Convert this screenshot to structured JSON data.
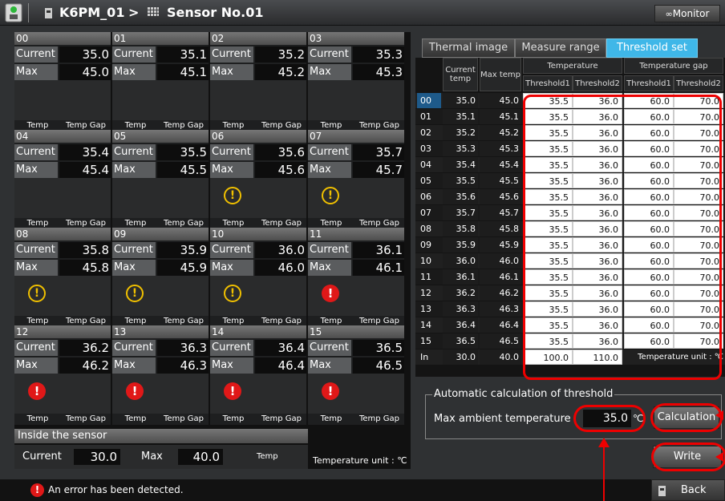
{
  "title": {
    "device": "K6PM_01",
    "separator": ">",
    "sensor": "Sensor No.01",
    "monitor_label": "Monitor"
  },
  "cell_labels": {
    "current": "Current",
    "max": "Max",
    "temp": "Temp",
    "temp_gap": "Temp Gap"
  },
  "cells": [
    {
      "id": "00",
      "current": "35.0",
      "max": "45.0",
      "status": "ok"
    },
    {
      "id": "01",
      "current": "35.1",
      "max": "45.1",
      "status": "ok"
    },
    {
      "id": "02",
      "current": "35.2",
      "max": "45.2",
      "status": "ok"
    },
    {
      "id": "03",
      "current": "35.3",
      "max": "45.3",
      "status": "ok"
    },
    {
      "id": "04",
      "current": "35.4",
      "max": "45.4",
      "status": "ok"
    },
    {
      "id": "05",
      "current": "35.5",
      "max": "45.5",
      "status": "ok"
    },
    {
      "id": "06",
      "current": "35.6",
      "max": "45.6",
      "status": "warning"
    },
    {
      "id": "07",
      "current": "35.7",
      "max": "45.7",
      "status": "warning"
    },
    {
      "id": "08",
      "current": "35.8",
      "max": "45.8",
      "status": "warning"
    },
    {
      "id": "09",
      "current": "35.9",
      "max": "45.9",
      "status": "warning"
    },
    {
      "id": "10",
      "current": "36.0",
      "max": "46.0",
      "status": "warning"
    },
    {
      "id": "11",
      "current": "36.1",
      "max": "46.1",
      "status": "error"
    },
    {
      "id": "12",
      "current": "36.2",
      "max": "46.2",
      "status": "error"
    },
    {
      "id": "13",
      "current": "36.3",
      "max": "46.3",
      "status": "error"
    },
    {
      "id": "14",
      "current": "36.4",
      "max": "46.4",
      "status": "error"
    },
    {
      "id": "15",
      "current": "36.5",
      "max": "46.5",
      "status": "error"
    }
  ],
  "inside_sensor": {
    "title": "Inside the sensor",
    "current_label": "Current",
    "current": "30.0",
    "max_label": "Max",
    "max": "40.0",
    "temp_label": "Temp"
  },
  "left_unit": "Temperature unit : ℃",
  "tabs": [
    {
      "label": "Thermal image",
      "active": false
    },
    {
      "label": "Measure range",
      "active": false
    },
    {
      "label": "Threshold set",
      "active": true
    }
  ],
  "table": {
    "header": {
      "current": "Current temp",
      "max": "Max temp",
      "temperature": "Temperature",
      "temperature_gap": "Temperature gap",
      "threshold1": "Threshold1",
      "threshold2": "Threshold2",
      "threshold1_gap": "Threshold1",
      "threshold2_gap": "Threshold2"
    },
    "rows": [
      {
        "id": "00",
        "current": "35.0",
        "max": "45.0",
        "t1": "35.5",
        "t2": "36.0",
        "g1": "60.0",
        "g2": "70.0"
      },
      {
        "id": "01",
        "current": "35.1",
        "max": "45.1",
        "t1": "35.5",
        "t2": "36.0",
        "g1": "60.0",
        "g2": "70.0"
      },
      {
        "id": "02",
        "current": "35.2",
        "max": "45.2",
        "t1": "35.5",
        "t2": "36.0",
        "g1": "60.0",
        "g2": "70.0"
      },
      {
        "id": "03",
        "current": "35.3",
        "max": "45.3",
        "t1": "35.5",
        "t2": "36.0",
        "g1": "60.0",
        "g2": "70.0"
      },
      {
        "id": "04",
        "current": "35.4",
        "max": "45.4",
        "t1": "35.5",
        "t2": "36.0",
        "g1": "60.0",
        "g2": "70.0"
      },
      {
        "id": "05",
        "current": "35.5",
        "max": "45.5",
        "t1": "35.5",
        "t2": "36.0",
        "g1": "60.0",
        "g2": "70.0"
      },
      {
        "id": "06",
        "current": "35.6",
        "max": "45.6",
        "t1": "35.5",
        "t2": "36.0",
        "g1": "60.0",
        "g2": "70.0"
      },
      {
        "id": "07",
        "current": "35.7",
        "max": "45.7",
        "t1": "35.5",
        "t2": "36.0",
        "g1": "60.0",
        "g2": "70.0"
      },
      {
        "id": "08",
        "current": "35.8",
        "max": "45.8",
        "t1": "35.5",
        "t2": "36.0",
        "g1": "60.0",
        "g2": "70.0"
      },
      {
        "id": "09",
        "current": "35.9",
        "max": "45.9",
        "t1": "35.5",
        "t2": "36.0",
        "g1": "60.0",
        "g2": "70.0"
      },
      {
        "id": "10",
        "current": "36.0",
        "max": "46.0",
        "t1": "35.5",
        "t2": "36.0",
        "g1": "60.0",
        "g2": "70.0"
      },
      {
        "id": "11",
        "current": "36.1",
        "max": "46.1",
        "t1": "35.5",
        "t2": "36.0",
        "g1": "60.0",
        "g2": "70.0"
      },
      {
        "id": "12",
        "current": "36.2",
        "max": "46.2",
        "t1": "35.5",
        "t2": "36.0",
        "g1": "60.0",
        "g2": "70.0"
      },
      {
        "id": "13",
        "current": "36.3",
        "max": "46.3",
        "t1": "35.5",
        "t2": "36.0",
        "g1": "60.0",
        "g2": "70.0"
      },
      {
        "id": "14",
        "current": "36.4",
        "max": "46.4",
        "t1": "35.5",
        "t2": "36.0",
        "g1": "60.0",
        "g2": "70.0"
      },
      {
        "id": "15",
        "current": "36.5",
        "max": "46.5",
        "t1": "35.5",
        "t2": "36.0",
        "g1": "60.0",
        "g2": "70.0"
      }
    ],
    "in_row": {
      "id": "In",
      "current": "30.0",
      "max": "40.0",
      "t1": "100.0",
      "t2": "110.0"
    },
    "unit": "Temperature unit : ℃"
  },
  "auto_calc": {
    "title": "Automatic calculation of threshold",
    "label": "Max ambient temperature",
    "value": "35.0",
    "unit": "℃",
    "button": "Calculation"
  },
  "write_button": "Write",
  "status_text": "An error has been detected.",
  "back_button": "Back",
  "colors": {
    "accent": "#3fb7e8",
    "error": "#e01818",
    "warning": "#f0c000",
    "highlight": "#ee0000"
  }
}
